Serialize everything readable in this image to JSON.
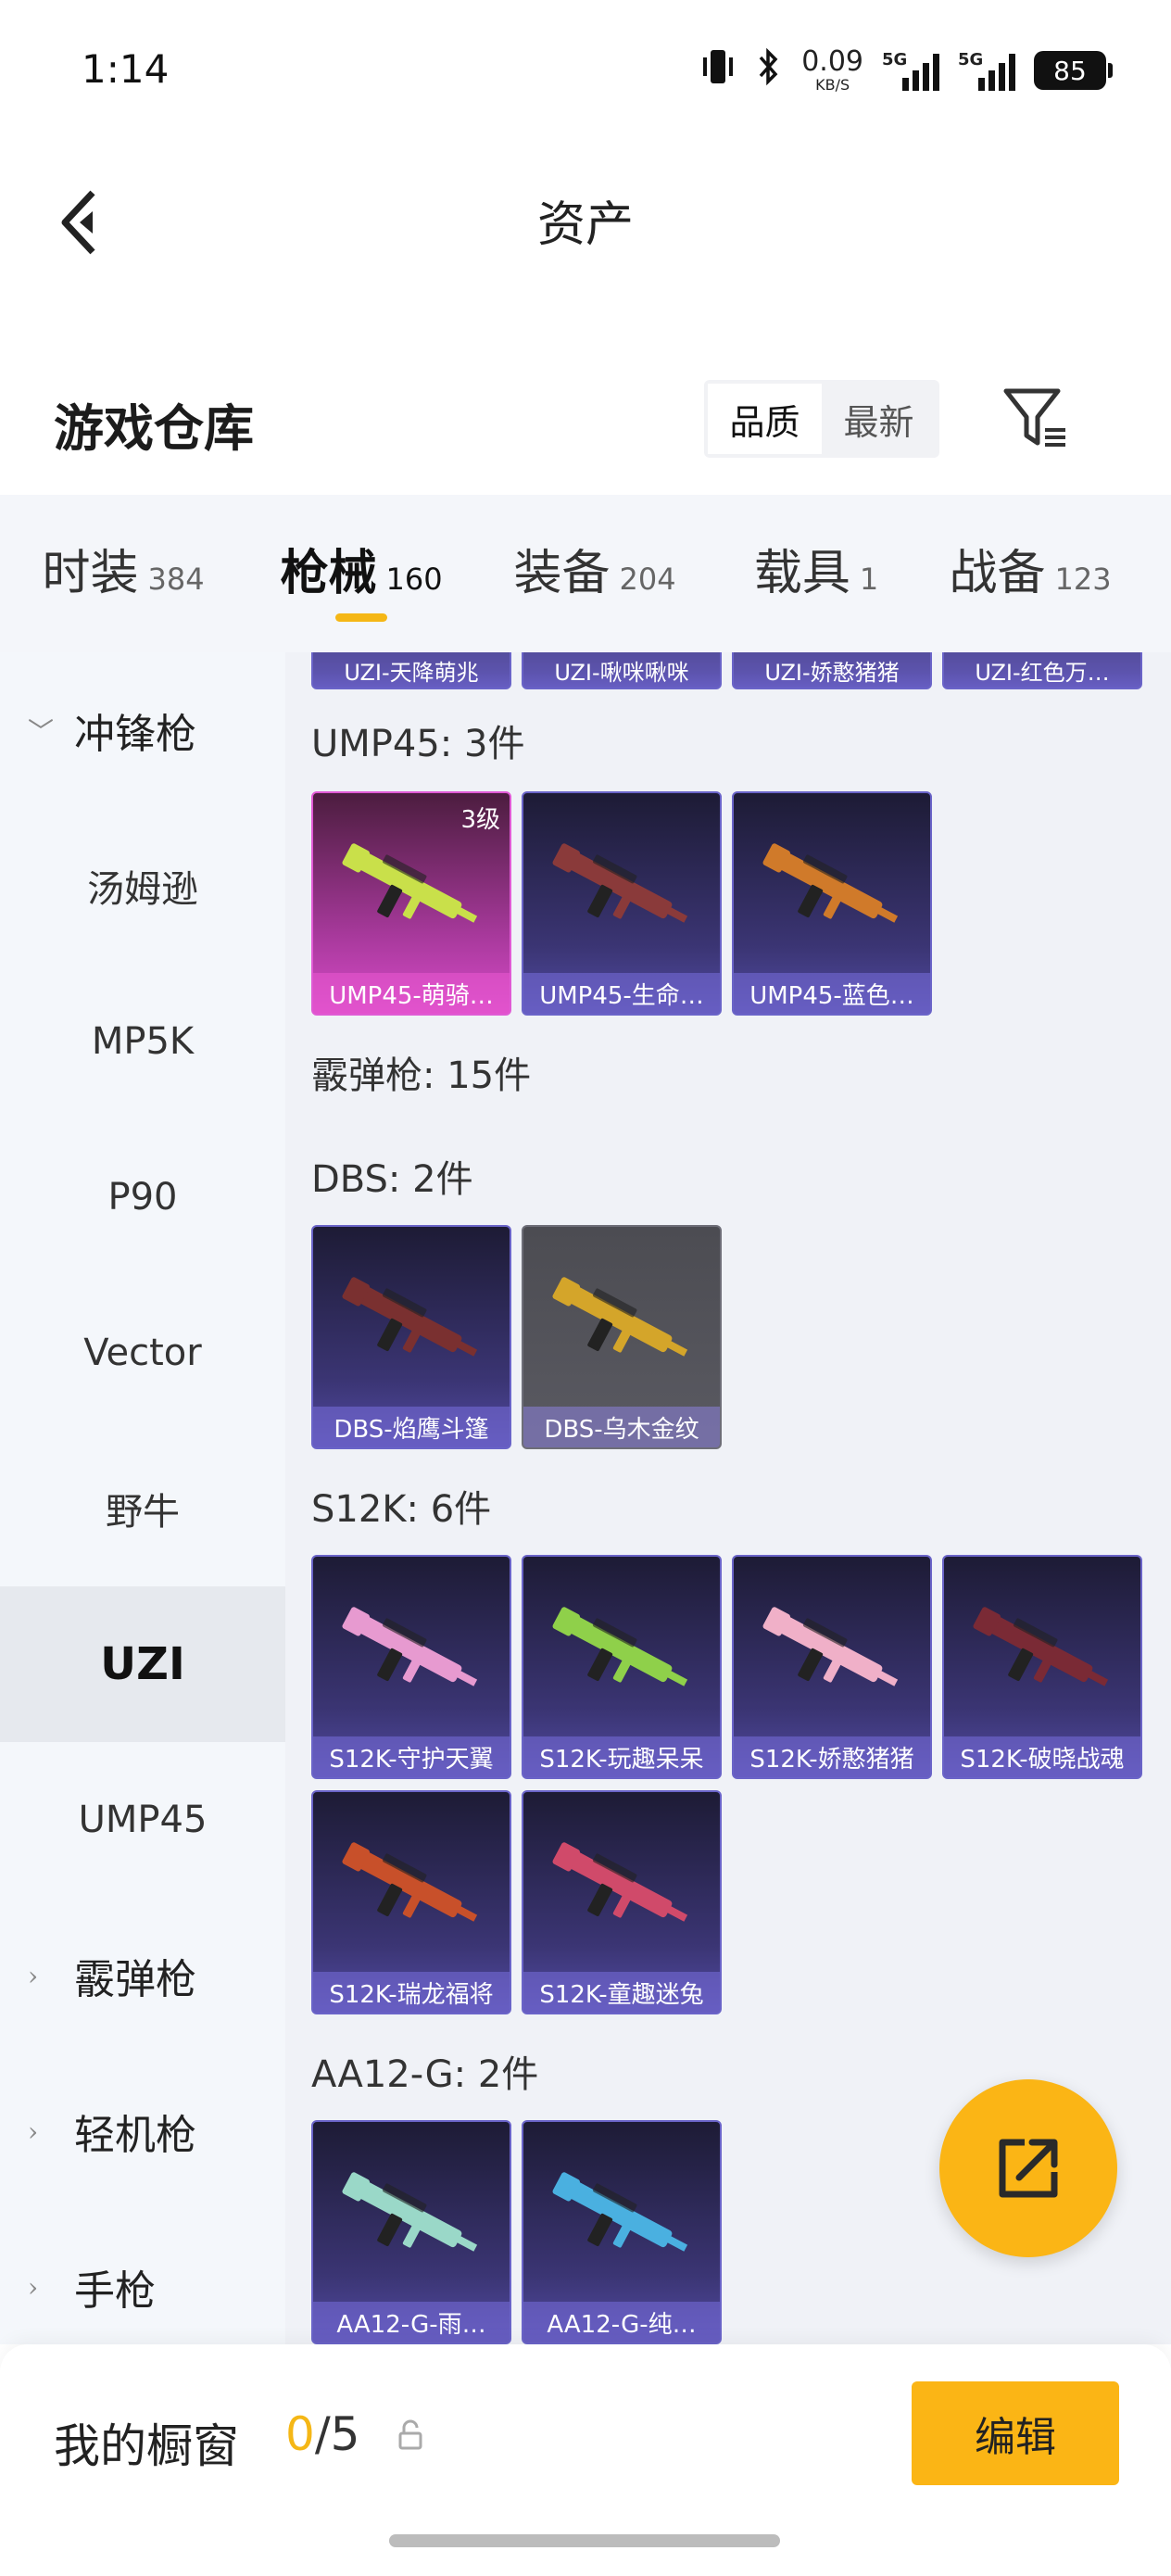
{
  "status_bar": {
    "time": "1:14",
    "net_speed_value": "0.09",
    "net_speed_unit": "KB/S",
    "signal1_tag": "5G",
    "signal2_tag": "5G",
    "battery": "85"
  },
  "header": {
    "title": "资产"
  },
  "warehouse": {
    "title": "游戏仓库",
    "sort_options": [
      "品质",
      "最新"
    ],
    "active_sort": "品质"
  },
  "category_tabs": [
    {
      "label": "时装",
      "count": "384"
    },
    {
      "label": "枪械",
      "count": "160"
    },
    {
      "label": "装备",
      "count": "204"
    },
    {
      "label": "载具",
      "count": "1"
    },
    {
      "label": "战备",
      "count": "123"
    }
  ],
  "sidebar": {
    "items": [
      {
        "label": "冲锋枪",
        "type": "group",
        "expanded": true
      },
      {
        "label": "汤姆逊",
        "type": "sub"
      },
      {
        "label": "MP5K",
        "type": "sub"
      },
      {
        "label": "P90",
        "type": "sub"
      },
      {
        "label": "Vector",
        "type": "sub"
      },
      {
        "label": "野牛",
        "type": "sub"
      },
      {
        "label": "UZI",
        "type": "sub",
        "active": true
      },
      {
        "label": "UMP45",
        "type": "sub"
      },
      {
        "label": "霰弹枪",
        "type": "group",
        "expanded": false
      },
      {
        "label": "轻机枪",
        "type": "group",
        "expanded": false
      },
      {
        "label": "手枪",
        "type": "group",
        "expanded": false
      }
    ]
  },
  "content": {
    "partial_row": [
      "UZI-天降萌兆",
      "UZI-啾咪啾咪",
      "UZI-娇憨猪猪",
      "UZI-红色万…"
    ],
    "sections": [
      {
        "title": "UMP45: 3件",
        "items": [
          {
            "name": "UMP45-萌骑…",
            "level": "3级",
            "rarity": "pink",
            "gun_color": "#c9e04a"
          },
          {
            "name": "UMP45-生命…",
            "rarity": "purple",
            "gun_color": "#8a3a3a"
          },
          {
            "name": "UMP45-蓝色…",
            "rarity": "purple",
            "gun_color": "#d07a2a"
          }
        ]
      },
      {
        "title": "霰弹枪: 15件",
        "items": []
      },
      {
        "title": "DBS: 2件",
        "items": [
          {
            "name": "DBS-焰鹰斗篷",
            "rarity": "purple",
            "gun_color": "#7a3030"
          },
          {
            "name": "DBS-乌木金纹",
            "rarity": "gray",
            "gun_color": "#d4a52a"
          }
        ]
      },
      {
        "title": "S12K: 6件",
        "items": [
          {
            "name": "S12K-守护天翼",
            "rarity": "purple",
            "gun_color": "#e79ad0"
          },
          {
            "name": "S12K-玩趣呆呆",
            "rarity": "purple",
            "gun_color": "#8fd04a"
          },
          {
            "name": "S12K-娇憨猪猪",
            "rarity": "purple",
            "gun_color": "#f0b0c8"
          },
          {
            "name": "S12K-破晓战魂",
            "rarity": "purple",
            "gun_color": "#7a2a35"
          },
          {
            "name": "S12K-瑞龙福将",
            "rarity": "purple",
            "gun_color": "#c8502a"
          },
          {
            "name": "S12K-童趣迷兔",
            "rarity": "purple",
            "gun_color": "#d04a6a"
          }
        ]
      },
      {
        "title": "AA12-G: 2件",
        "items": [
          {
            "name": "AA12-G-雨…",
            "rarity": "purple",
            "gun_color": "#9ad8c8"
          },
          {
            "name": "AA12-G-纯…",
            "rarity": "purple",
            "gun_color": "#4ab0e0"
          }
        ]
      }
    ]
  },
  "fab": {
    "icon": "share-external-icon"
  },
  "bottom_bar": {
    "showcase_label": "我的橱窗",
    "showcase_current": "0",
    "showcase_total": "/5",
    "edit_label": "编辑"
  },
  "colors": {
    "accent": "#fbb515",
    "card_purple": "#3b3574",
    "card_pink": "#a8399c",
    "card_gray": "#5a5a62"
  }
}
